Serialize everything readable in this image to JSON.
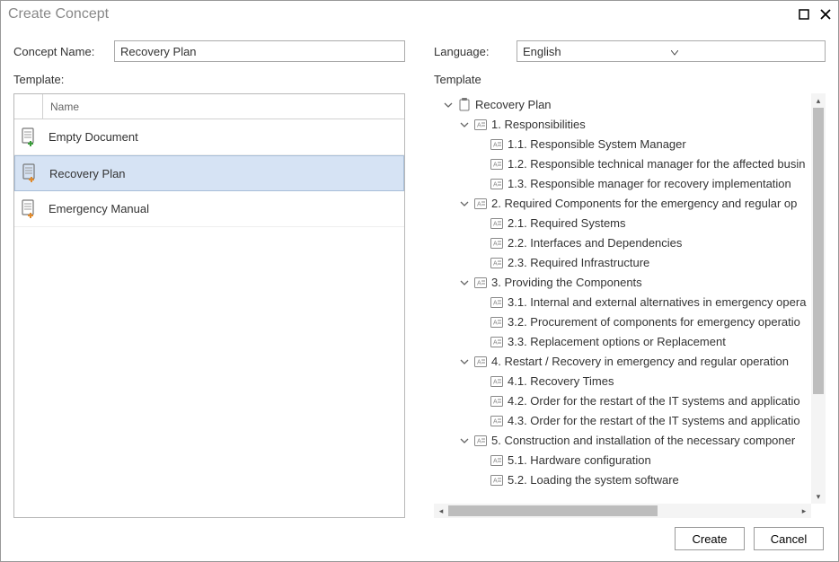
{
  "window": {
    "title": "Create Concept"
  },
  "labels": {
    "concept_name": "Concept Name:",
    "language": "Language:",
    "template_left": "Template:",
    "template_right": "Template",
    "list_header_name": "Name"
  },
  "fields": {
    "concept_name_value": "Recovery Plan",
    "language_value": "English"
  },
  "templates": [
    {
      "icon": "doc-plus-green",
      "name": "Empty Document",
      "selected": false
    },
    {
      "icon": "doc-plus-orange",
      "name": "Recovery Plan",
      "selected": true
    },
    {
      "icon": "doc-plus-orange",
      "name": "Emergency Manual",
      "selected": false
    }
  ],
  "tree": {
    "root": {
      "label": "Recovery Plan"
    },
    "sections": [
      {
        "label": "1. Responsibilities",
        "items": [
          "1.1. Responsible System Manager",
          "1.2. Responsible technical manager for the affected busin",
          "1.3. Responsible manager for recovery implementation"
        ]
      },
      {
        "label": "2. Required Components for the emergency and regular op",
        "items": [
          "2.1. Required Systems",
          "2.2. Interfaces and Dependencies",
          "2.3. Required Infrastructure"
        ]
      },
      {
        "label": "3. Providing the Components",
        "items": [
          "3.1. Internal and external alternatives in emergency opera",
          "3.2. Procurement of components for emergency operatio",
          "3.3. Replacement options or Replacement"
        ]
      },
      {
        "label": "4. Restart / Recovery in emergency and regular operation",
        "items": [
          "4.1. Recovery Times",
          "4.2. Order for the restart of the IT systems and applicatio",
          "4.3. Order for the restart of the IT systems and applicatio"
        ]
      },
      {
        "label": "5. Construction and installation of the necessary componer",
        "items": [
          "5.1. Hardware configuration",
          "5.2. Loading the system software"
        ]
      }
    ]
  },
  "buttons": {
    "create": "Create",
    "cancel": "Cancel"
  }
}
